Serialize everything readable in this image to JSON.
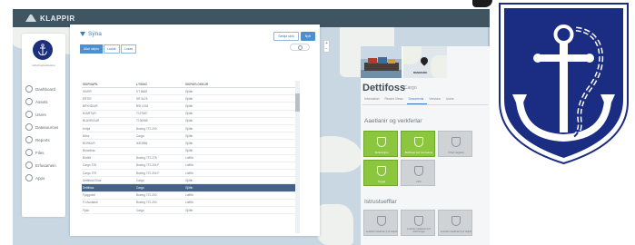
{
  "app": {
    "brand": "KLAPPIR"
  },
  "sidebar": {
    "org_label": "skibsfragtselskabet",
    "items": [
      {
        "label": "Dashboard",
        "icon": "dashboard-icon"
      },
      {
        "label": "Assets",
        "icon": "assets-icon"
      },
      {
        "label": "Users",
        "icon": "users-icon"
      },
      {
        "label": "Datasources",
        "icon": "datasources-icon"
      },
      {
        "label": "Reports",
        "icon": "reports-icon"
      },
      {
        "label": "Files",
        "icon": "files-icon"
      },
      {
        "label": "Erfusamein",
        "icon": "check-icon"
      },
      {
        "label": "Apps",
        "icon": "apps-icon"
      }
    ]
  },
  "panel": {
    "filter_title": "Sýna",
    "chips": [
      {
        "label": "Allar skipin",
        "active": true
      },
      {
        "label": "Laddir",
        "active": false
      },
      {
        "label": "Losad",
        "active": false
      }
    ],
    "buttons": [
      {
        "label": "Sækja skrá",
        "primary": false
      },
      {
        "label": "Nýtt",
        "primary": true
      }
    ],
    "columns": [
      "SKIPNAFN",
      "LÝSING",
      "SKIPAFLOKKUR"
    ],
    "rows": [
      [
        "SKIRR",
        "KT 6665",
        "Gjöfin"
      ],
      [
        "ÉRTIR",
        "SR 5476",
        "Gjöfin"
      ],
      [
        "BRYNDIUR",
        "BSI 1034",
        "Gjöfin"
      ],
      [
        "BJARTUR",
        "T127667",
        "Gjöfin"
      ],
      [
        "BLÁVEIGUR",
        "T130085",
        "Gjöfin"
      ],
      [
        "Þriðjá",
        "Boeing 737-200",
        "Gjöfin"
      ],
      [
        "Bíkur",
        "Cargo",
        "Gjöfin"
      ],
      [
        "BORKUR",
        "IKE3966",
        "Gjöfin"
      ],
      [
        "Brúarfoss",
        "",
        "Gjöfin"
      ],
      [
        "Búrfell",
        "Boeing 737-278",
        "Loftför"
      ],
      [
        "Cargo 378",
        "Boeing 737-204 F",
        "Loftför"
      ],
      [
        "Cargo 379",
        "Boeing 737-204 F",
        "Loftför"
      ],
      [
        "Dettifoss Elías",
        "Cargo",
        "Gjöfin"
      ],
      [
        "Dettifoss",
        "Cargo",
        "Gjöfin"
      ],
      [
        "Fjoggufoll",
        "Boeing 737-200",
        "Loftför"
      ],
      [
        "FJ Ausbasti",
        "Boeing 737-200",
        "Loftför"
      ],
      [
        "Fjúla",
        "Cargo",
        "Gjöfin"
      ]
    ],
    "selected_row": 13
  },
  "detail": {
    "ship_name": "Dettifoss",
    "ship_type": "Cargo",
    "map_label": "DENMARK",
    "tabs": [
      {
        "label": "Information",
        "active": false
      },
      {
        "label": "Recent Views",
        "active": false
      },
      {
        "label": "Documents",
        "active": true
      },
      {
        "label": "Versions",
        "active": false
      },
      {
        "label": "Users",
        "active": false
      }
    ],
    "section1_title": "Aaetlanir og verkferlar",
    "section1_tiles": [
      {
        "label": "Skráninginu",
        "color": "green"
      },
      {
        "label": "Borfingur fyrir kennsluna",
        "color": "green"
      },
      {
        "label": "Úthal velgskrá",
        "color": "gray"
      },
      {
        "label": "Öryggi",
        "color": "green"
      },
      {
        "label": "ISM",
        "color": "gray"
      }
    ],
    "section2_title": "Istrustuefflar",
    "section2_tiles": [
      {
        "label": "Lesbók maskinar fyrir skipið",
        "color": "gray"
      },
      {
        "label": "Lesbók maskinar fyrir áhöfnunga",
        "color": "gray"
      },
      {
        "label": "Lesbók maskinar fyrir skipið",
        "color": "gray"
      }
    ]
  },
  "colors": {
    "topbar": "#3f5561",
    "accent": "#3c7bbd",
    "selected_row": "#45618a",
    "tile_green": "#8cc63f",
    "badge_blue": "#1b2d83"
  }
}
